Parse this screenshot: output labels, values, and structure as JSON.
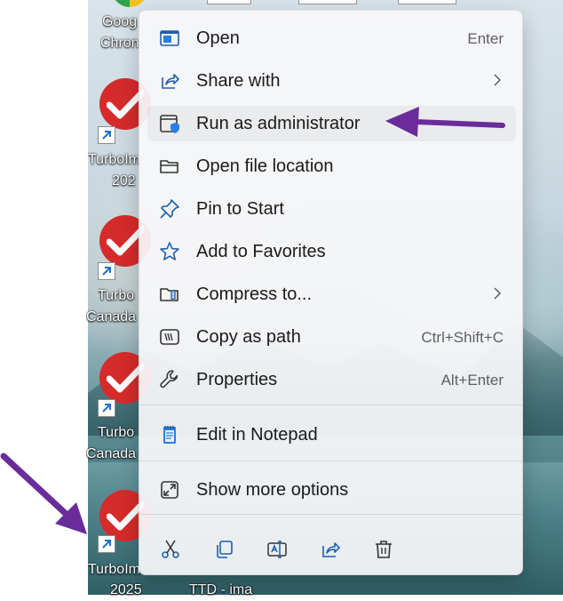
{
  "desktop": {
    "icons": [
      {
        "label_line1": "Goog",
        "label_line2": "Chron"
      },
      {
        "label_line1": "TurboIm",
        "label_line2": "202"
      },
      {
        "label_line1": "Turbo",
        "label_line2": "Canada"
      },
      {
        "label_line1": "Turbo",
        "label_line2": "Canada"
      },
      {
        "label_line1": "TurboIm",
        "label_line2": "2025"
      }
    ],
    "bottom_label": "TTD - ima"
  },
  "menu": {
    "items": [
      {
        "label": "Open",
        "shortcut": "Enter",
        "icon": "open-icon"
      },
      {
        "label": "Share with",
        "shortcut": "",
        "icon": "share-with-icon",
        "submenu": true
      },
      {
        "label": "Run as administrator",
        "shortcut": "",
        "icon": "admin-shield-icon"
      },
      {
        "label": "Open file location",
        "shortcut": "",
        "icon": "folder-icon"
      },
      {
        "label": "Pin to Start",
        "shortcut": "",
        "icon": "pin-icon"
      },
      {
        "label": "Add to Favorites",
        "shortcut": "",
        "icon": "star-icon"
      },
      {
        "label": "Compress to...",
        "shortcut": "",
        "icon": "zip-folder-icon",
        "submenu": true
      },
      {
        "label": "Copy as path",
        "shortcut": "Ctrl+Shift+C",
        "icon": "copy-path-icon"
      },
      {
        "label": "Properties",
        "shortcut": "Alt+Enter",
        "icon": "wrench-icon"
      },
      {
        "label": "Edit in Notepad",
        "shortcut": "",
        "icon": "notepad-icon"
      },
      {
        "label": "Show more options",
        "shortcut": "",
        "icon": "show-more-icon"
      }
    ],
    "toolbar": [
      "cut-icon",
      "copy-icon",
      "rename-icon",
      "share-icon",
      "delete-icon"
    ]
  },
  "colors": {
    "accent": "#2b7de1",
    "annotation_arrow": "#6a2c9a",
    "turbotax_red": "#d62b2b"
  }
}
